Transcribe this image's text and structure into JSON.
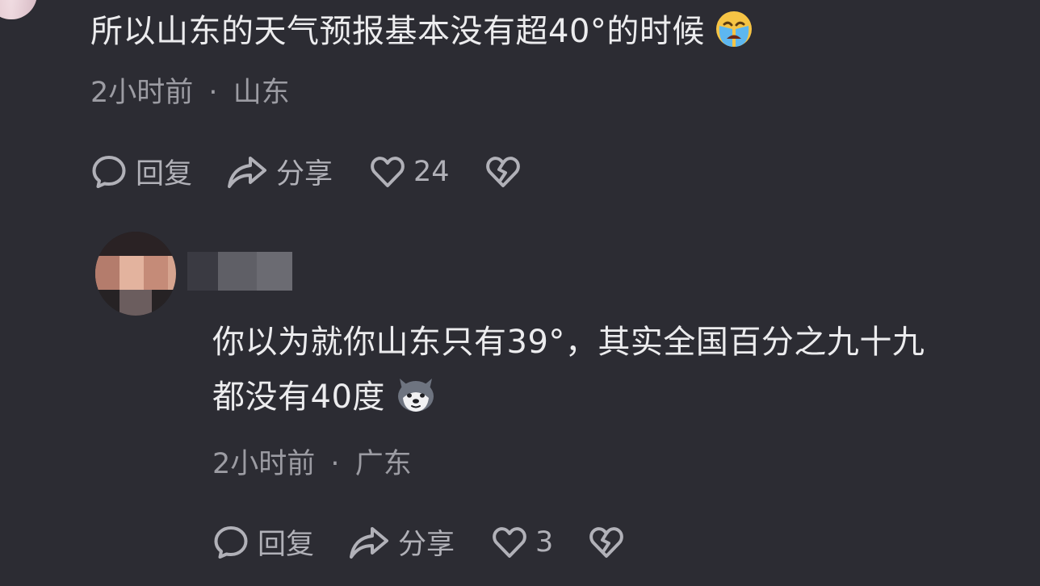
{
  "comments": [
    {
      "text": "所以山东的天气预报基本没有超40°的时候",
      "emoji": "loudly-crying-face",
      "time": "2小时前",
      "separator": "·",
      "location": "山东",
      "reply_label": "回复",
      "share_label": "分享",
      "like_count": "24"
    },
    {
      "text_line1": "你以为就你山东只有39°，其实全国百分之九十九",
      "text_line2": "都没有40度",
      "emoji": "husky-dog-face",
      "time": "2小时前",
      "separator": "·",
      "location": "广东",
      "reply_label": "回复",
      "share_label": "分享",
      "like_count": "3"
    }
  ],
  "colors": {
    "background": "#2c2c33",
    "text": "#ececee",
    "meta": "#9c9ca3",
    "icon": "#b1b1b8"
  }
}
